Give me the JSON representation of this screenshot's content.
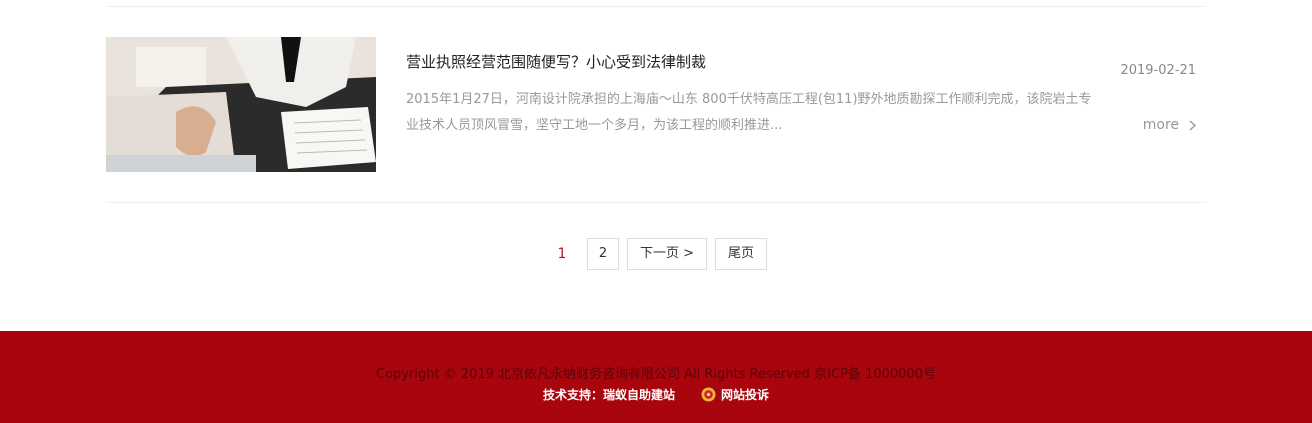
{
  "article": {
    "title": "营业执照经营范围随便写？小心受到法律制裁",
    "summary": "2015年1月27日，河南设计院承担的上海庙～山东 800千伏特高压工程(包11)野外地质勘探工作顺利完成，该院岩土专业技术人员顶风冒雪，坚守工地一个多月，为该工程的顺利推进...",
    "date": "2019-02-21",
    "more_label": "more"
  },
  "pagination": {
    "current": "1",
    "page2": "2",
    "next": "下一页 >",
    "last": "尾页"
  },
  "footer": {
    "copyright": "Copyright © 2019 北京依凡永纳财务咨询有限公司 All Rights Reserved   京ICP备 1000000号",
    "support": "技术支持：瑞蚁自助建站",
    "complaint": "网站投诉"
  },
  "colors": {
    "footer_bg": "#a8050d",
    "current_page": "#c30d23"
  }
}
